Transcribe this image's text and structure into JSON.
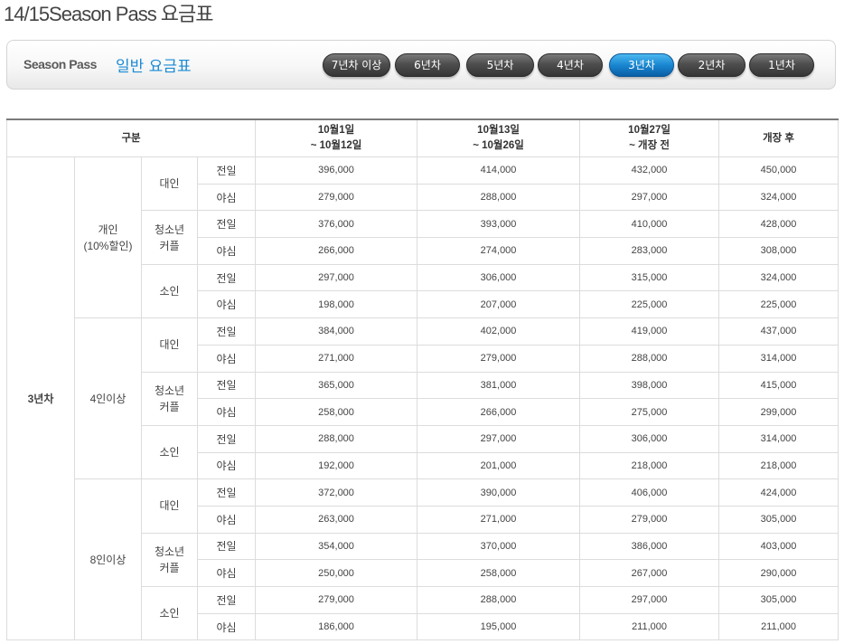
{
  "page_title": "14/15Season Pass 요금표",
  "panel": {
    "brand": "Season Pass",
    "subtitle": "일반 요금표"
  },
  "tabs": [
    {
      "label": "7년차 이상",
      "active": false
    },
    {
      "label": "6년차",
      "active": false
    },
    {
      "label": "5년차",
      "active": false
    },
    {
      "label": "4년차",
      "active": false
    },
    {
      "label": "3년차",
      "active": true
    },
    {
      "label": "2년차",
      "active": false
    },
    {
      "label": "1년차",
      "active": false
    }
  ],
  "table": {
    "header": {
      "category": "구분",
      "periods": [
        [
          "10월1일",
          "~ 10월12일"
        ],
        [
          "10월13일",
          "~ 10월26일"
        ],
        [
          "10월27일",
          "~ 개장 전"
        ],
        [
          "개장 후"
        ]
      ]
    },
    "year": "3년차",
    "groups": [
      {
        "label": [
          "개인",
          "(10%할인)"
        ],
        "types": [
          {
            "label": [
              "대인"
            ],
            "rows": [
              {
                "kind": "전일",
                "prices": [
                  "396,000",
                  "414,000",
                  "432,000",
                  "450,000"
                ]
              },
              {
                "kind": "야심",
                "prices": [
                  "279,000",
                  "288,000",
                  "297,000",
                  "324,000"
                ]
              }
            ]
          },
          {
            "label": [
              "청소년",
              "커플"
            ],
            "rows": [
              {
                "kind": "전일",
                "prices": [
                  "376,000",
                  "393,000",
                  "410,000",
                  "428,000"
                ]
              },
              {
                "kind": "야심",
                "prices": [
                  "266,000",
                  "274,000",
                  "283,000",
                  "308,000"
                ]
              }
            ]
          },
          {
            "label": [
              "소인"
            ],
            "rows": [
              {
                "kind": "전일",
                "prices": [
                  "297,000",
                  "306,000",
                  "315,000",
                  "324,000"
                ]
              },
              {
                "kind": "야심",
                "prices": [
                  "198,000",
                  "207,000",
                  "225,000",
                  "225,000"
                ]
              }
            ]
          }
        ]
      },
      {
        "label": [
          "4인이상"
        ],
        "types": [
          {
            "label": [
              "대인"
            ],
            "rows": [
              {
                "kind": "전일",
                "prices": [
                  "384,000",
                  "402,000",
                  "419,000",
                  "437,000"
                ]
              },
              {
                "kind": "야심",
                "prices": [
                  "271,000",
                  "279,000",
                  "288,000",
                  "314,000"
                ]
              }
            ]
          },
          {
            "label": [
              "청소년",
              "커플"
            ],
            "rows": [
              {
                "kind": "전일",
                "prices": [
                  "365,000",
                  "381,000",
                  "398,000",
                  "415,000"
                ]
              },
              {
                "kind": "야심",
                "prices": [
                  "258,000",
                  "266,000",
                  "275,000",
                  "299,000"
                ]
              }
            ]
          },
          {
            "label": [
              "소인"
            ],
            "rows": [
              {
                "kind": "전일",
                "prices": [
                  "288,000",
                  "297,000",
                  "306,000",
                  "314,000"
                ]
              },
              {
                "kind": "야심",
                "prices": [
                  "192,000",
                  "201,000",
                  "218,000",
                  "218,000"
                ]
              }
            ]
          }
        ]
      },
      {
        "label": [
          "8인이상"
        ],
        "types": [
          {
            "label": [
              "대인"
            ],
            "rows": [
              {
                "kind": "전일",
                "prices": [
                  "372,000",
                  "390,000",
                  "406,000",
                  "424,000"
                ]
              },
              {
                "kind": "야심",
                "prices": [
                  "263,000",
                  "271,000",
                  "279,000",
                  "305,000"
                ]
              }
            ]
          },
          {
            "label": [
              "청소년",
              "커플"
            ],
            "rows": [
              {
                "kind": "전일",
                "prices": [
                  "354,000",
                  "370,000",
                  "386,000",
                  "403,000"
                ]
              },
              {
                "kind": "야심",
                "prices": [
                  "250,000",
                  "258,000",
                  "267,000",
                  "290,000"
                ]
              }
            ]
          },
          {
            "label": [
              "소인"
            ],
            "rows": [
              {
                "kind": "전일",
                "prices": [
                  "279,000",
                  "288,000",
                  "297,000",
                  "305,000"
                ]
              },
              {
                "kind": "야심",
                "prices": [
                  "186,000",
                  "195,000",
                  "211,000",
                  "211,000"
                ]
              }
            ]
          }
        ]
      }
    ]
  }
}
